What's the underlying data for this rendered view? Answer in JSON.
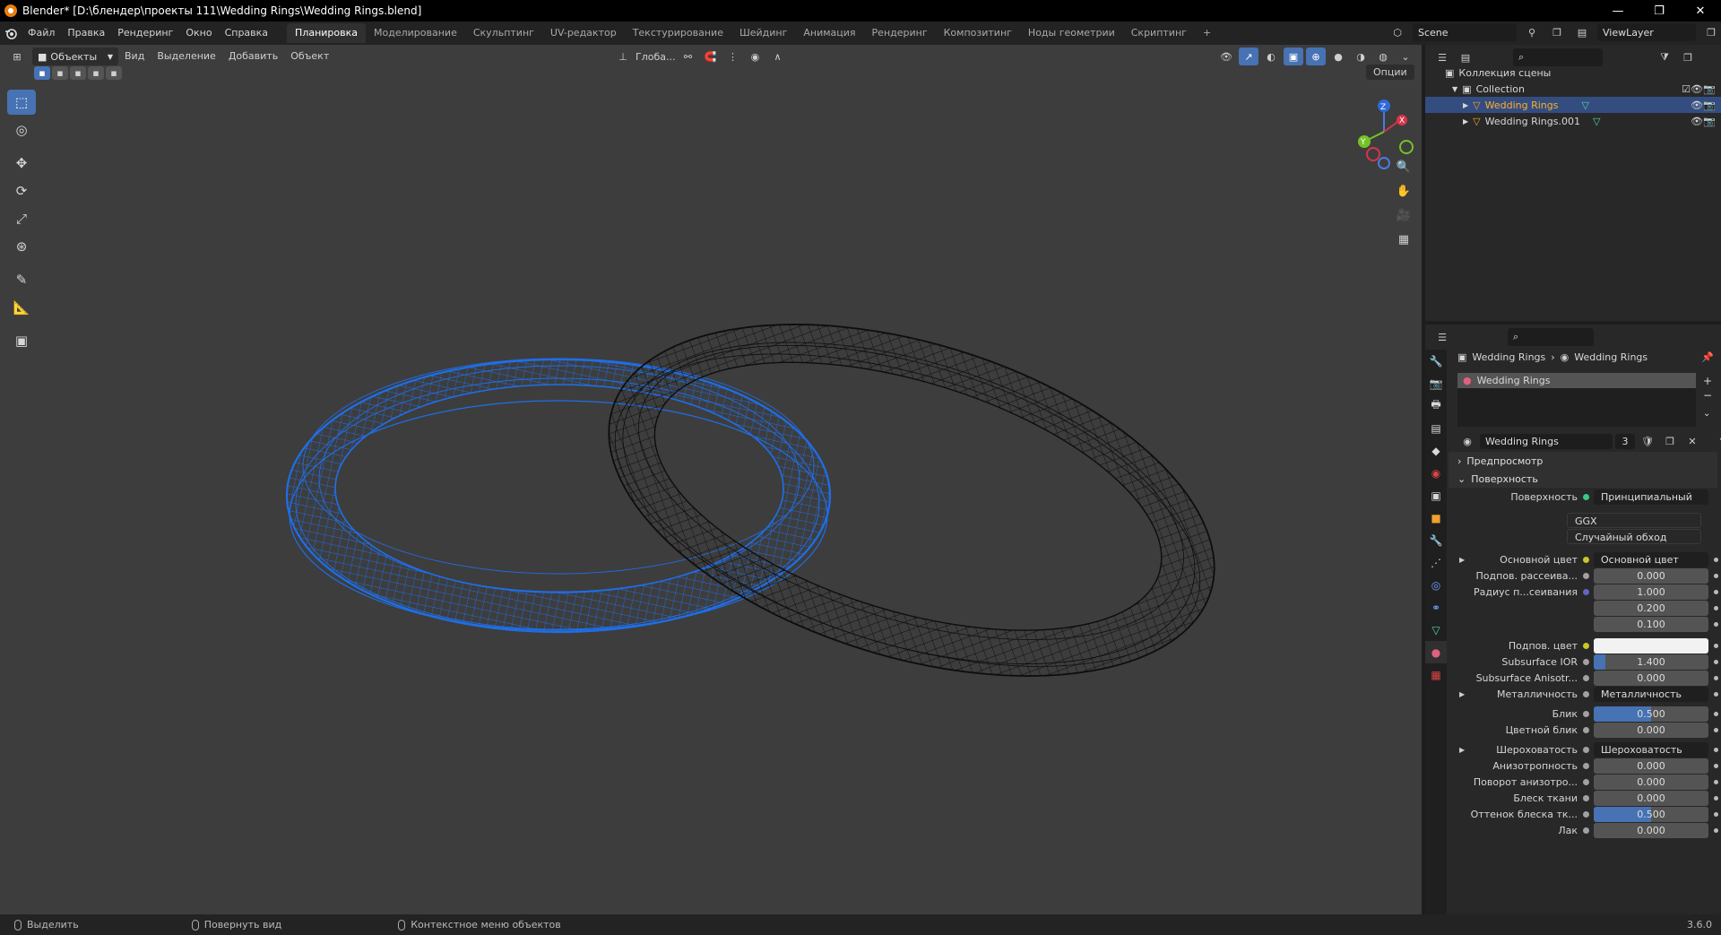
{
  "title_bar": {
    "title": "Blender* [D:\\блендер\\проекты 111\\Wedding Rings\\Wedding Rings.blend]"
  },
  "window_controls": {
    "minimize": "—",
    "maximize": "❐",
    "close": "✕"
  },
  "menu": [
    "Файл",
    "Правка",
    "Рендеринг",
    "Окно",
    "Справка"
  ],
  "workspaces": [
    {
      "label": "Планировка",
      "active": true
    },
    {
      "label": "Моделирование"
    },
    {
      "label": "Скульптинг"
    },
    {
      "label": "UV-редактор"
    },
    {
      "label": "Текстурирование"
    },
    {
      "label": "Шейдинг"
    },
    {
      "label": "Анимация"
    },
    {
      "label": "Рендеринг"
    },
    {
      "label": "Композитинг"
    },
    {
      "label": "Ноды геометрии"
    },
    {
      "label": "Скриптинг"
    }
  ],
  "add_workspace": "+",
  "scene": {
    "name": "Scene"
  },
  "view_layer": {
    "name": "ViewLayer"
  },
  "viewport": {
    "mode": "Объекты",
    "menus": [
      "Вид",
      "Выделение",
      "Добавить",
      "Объект"
    ],
    "transform_orientation": "Глоба...",
    "options": "Опции",
    "gizmo_axes": {
      "x": "X",
      "y": "Y",
      "z": "Z"
    }
  },
  "outliner": {
    "scene_collection": "Коллекция сцены",
    "collection": "Collection",
    "objects": [
      {
        "name": "Wedding Rings",
        "selected": true
      },
      {
        "name": "Wedding Rings.001",
        "selected": false
      }
    ]
  },
  "properties": {
    "breadcrumb_object": "Wedding Rings",
    "breadcrumb_material": "Wedding Rings",
    "material_slot": "Wedding Rings",
    "material_name": "Wedding Rings",
    "users": "3",
    "sections": {
      "preview": "Предпросмотр",
      "surface": "Поверхность"
    },
    "surface_label": "Поверхность",
    "surface_value": "Принципиальный BSDF",
    "distribution": "GGX",
    "subsurface_method": "Случайный обход",
    "rows": [
      {
        "label": "Основной цвет",
        "value": "Основной цвет",
        "kind": "link",
        "dot": "#c7c729",
        "expand": true
      },
      {
        "label": "Подпов. рассеива...",
        "value": "0.000",
        "kind": "num",
        "dot": "#a1a1a1"
      },
      {
        "label": "Радиус п...сеивания",
        "value": "1.000",
        "kind": "num",
        "dot": "#6363c7"
      },
      {
        "label": "",
        "value": "0.200",
        "kind": "num"
      },
      {
        "label": "",
        "value": "0.100",
        "kind": "num"
      },
      {
        "label": "Подпов. цвет",
        "value": "",
        "kind": "color",
        "dot": "#c7c729"
      },
      {
        "label": "Subsurface IOR",
        "value": "1.400",
        "kind": "num",
        "dot": "#a1a1a1",
        "fill": 0.1
      },
      {
        "label": "Subsurface Anisotr...",
        "value": "0.000",
        "kind": "num",
        "dot": "#a1a1a1"
      },
      {
        "label": "Металличность",
        "value": "Металличность",
        "kind": "link",
        "dot": "#a1a1a1",
        "expand": true
      },
      {
        "label": "Блик",
        "value": "0.500",
        "kind": "num",
        "dot": "#a1a1a1",
        "fill": 0.5
      },
      {
        "label": "Цветной блик",
        "value": "0.000",
        "kind": "num",
        "dot": "#a1a1a1"
      },
      {
        "label": "Шероховатость",
        "value": "Шероховатость",
        "kind": "link",
        "dot": "#a1a1a1",
        "expand": true
      },
      {
        "label": "Анизотропность",
        "value": "0.000",
        "kind": "num",
        "dot": "#a1a1a1"
      },
      {
        "label": "Поворот анизотро...",
        "value": "0.000",
        "kind": "num",
        "dot": "#a1a1a1"
      },
      {
        "label": "Блеск ткани",
        "value": "0.000",
        "kind": "num",
        "dot": "#a1a1a1"
      },
      {
        "label": "Оттенок блеска тк...",
        "value": "0.500",
        "kind": "num",
        "dot": "#a1a1a1",
        "fill": 0.5
      },
      {
        "label": "Лак",
        "value": "0.000",
        "kind": "num",
        "dot": "#a1a1a1"
      }
    ]
  },
  "statusbar": {
    "select": "Выделить",
    "rotate": "Повернуть вид",
    "context": "Контекстное меню объектов",
    "version": "3.6.0"
  },
  "colors": {
    "accent": "#4772b3",
    "selected_ring": "#1f6ee8",
    "other_ring": "#000000",
    "active_object_text": "#ffaf29"
  }
}
